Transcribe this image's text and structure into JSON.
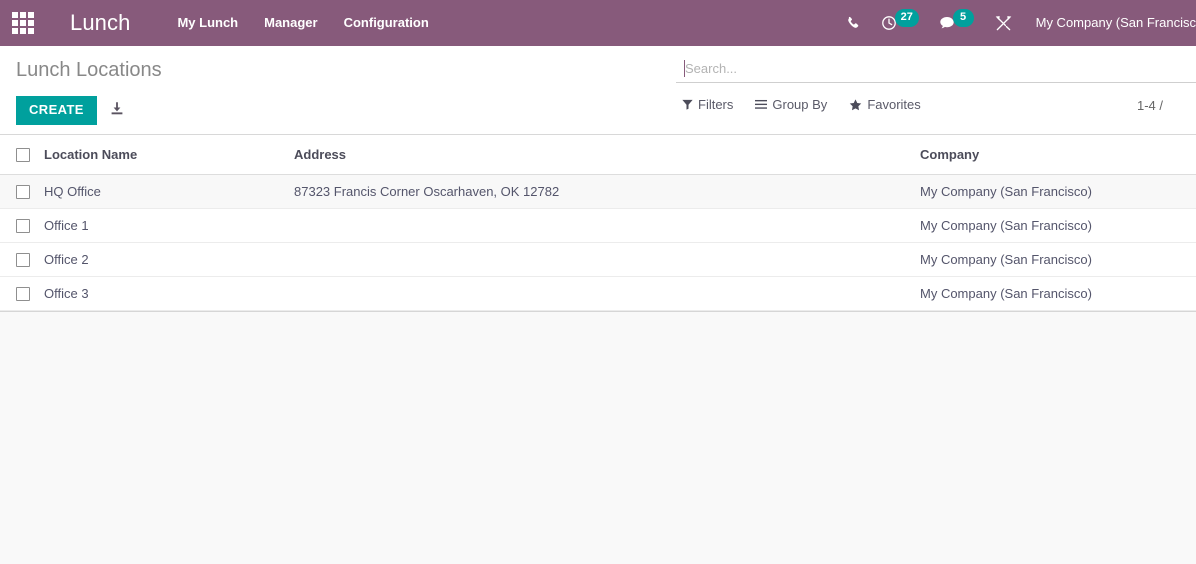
{
  "navbar": {
    "apps_icon": "apps-grid-icon",
    "brand": "Lunch",
    "menu": [
      {
        "label": "My Lunch"
      },
      {
        "label": "Manager"
      },
      {
        "label": "Configuration"
      }
    ],
    "icons": [
      {
        "name": "phone-icon",
        "badge": null
      },
      {
        "name": "activity-clock-icon",
        "badge": "27"
      },
      {
        "name": "messages-icon",
        "badge": "5"
      },
      {
        "name": "debug-tools-icon",
        "badge": null
      }
    ],
    "user_company": "My Company (San Francisc",
    "background_color": "#875A7B",
    "badge_color": "#00A09D"
  },
  "control_panel": {
    "breadcrumb": "Lunch Locations",
    "create_label": "CREATE",
    "import_icon": "import-download-icon",
    "create_color": "#00A09D",
    "search": {
      "placeholder": "Search...",
      "value": ""
    },
    "search_buttons": [
      {
        "label": "Filters",
        "icon": "filter-funnel-icon"
      },
      {
        "label": "Group By",
        "icon": "group-by-list-icon"
      },
      {
        "label": "Favorites",
        "icon": "favorites-star-icon"
      }
    ],
    "pager": "1-4 /"
  },
  "list_view": {
    "columns": [
      {
        "key": "select",
        "label": ""
      },
      {
        "key": "name",
        "label": "Location Name"
      },
      {
        "key": "address",
        "label": "Address"
      },
      {
        "key": "company",
        "label": "Company"
      }
    ],
    "rows": [
      {
        "name": "HQ Office",
        "address": "87323 Francis Corner Oscarhaven, OK 12782",
        "company": "My Company (San Francisco)",
        "hovered": true
      },
      {
        "name": "Office 1",
        "address": "",
        "company": "My Company (San Francisco)",
        "hovered": false
      },
      {
        "name": "Office 2",
        "address": "",
        "company": "My Company (San Francisco)",
        "hovered": false
      },
      {
        "name": "Office 3",
        "address": "",
        "company": "My Company (San Francisco)",
        "hovered": false
      }
    ]
  }
}
